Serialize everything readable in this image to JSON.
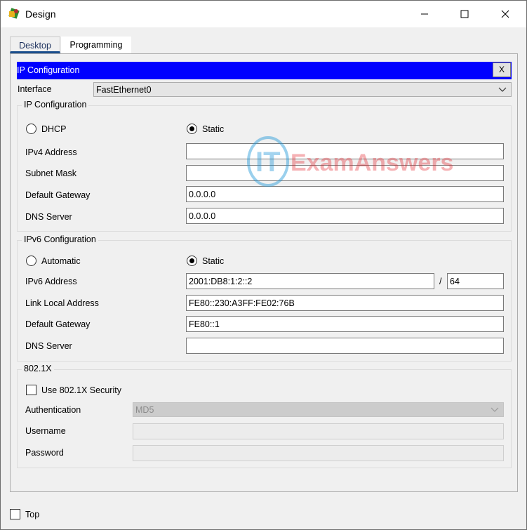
{
  "window": {
    "title": "Design"
  },
  "tabs": [
    {
      "label": "Desktop"
    },
    {
      "label": "Programming"
    }
  ],
  "header": {
    "title": "IP Configuration",
    "close_label": "X"
  },
  "interface": {
    "label": "Interface",
    "value": "FastEthernet0"
  },
  "ipv4": {
    "group_title": "IP Configuration",
    "dhcp_label": "DHCP",
    "static_label": "Static",
    "mode": "Static",
    "address_label": "IPv4 Address",
    "address": "",
    "mask_label": "Subnet Mask",
    "mask": "",
    "gateway_label": "Default Gateway",
    "gateway": "0.0.0.0",
    "dns_label": "DNS Server",
    "dns": "0.0.0.0"
  },
  "ipv6": {
    "group_title": "IPv6 Configuration",
    "auto_label": "Automatic",
    "static_label": "Static",
    "mode": "Static",
    "address_label": "IPv6 Address",
    "address": "2001:DB8:1:2::2",
    "slash": "/",
    "prefix": "64",
    "link_local_label": "Link Local Address",
    "link_local": "FE80::230:A3FF:FE02:76B",
    "gateway_label": "Default Gateway",
    "gateway": "FE80::1",
    "dns_label": "DNS Server",
    "dns": ""
  },
  "dot1x": {
    "group_title": "802.1X",
    "use_label": "Use 802.1X Security",
    "use_checked": false,
    "auth_label": "Authentication",
    "auth_value": "MD5",
    "username_label": "Username",
    "username": "",
    "password_label": "Password",
    "password": ""
  },
  "footer": {
    "top_label": "Top",
    "top_checked": false
  },
  "watermark": {
    "it": "IT",
    "text": "ExamAnswers"
  },
  "colors": {
    "header_bg": "#0000ff",
    "tab_underline": "#1a4e8c",
    "watermark_blue": "#1e96d8",
    "watermark_red": "#e4222a"
  }
}
